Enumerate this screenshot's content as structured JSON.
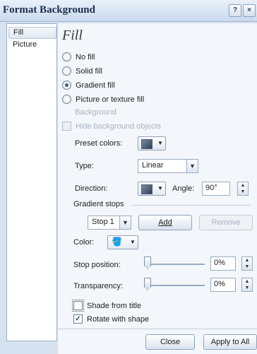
{
  "window": {
    "title": "Format Background",
    "help_glyph": "?",
    "close_glyph": "×"
  },
  "nav": {
    "items": [
      {
        "label": "Fill",
        "selected": true
      },
      {
        "label": "Picture",
        "selected": false
      }
    ]
  },
  "panel": {
    "heading": "Fill",
    "fill_options": [
      {
        "label": "No fill",
        "selected": false
      },
      {
        "label": "Solid fill",
        "selected": false
      },
      {
        "label": "Gradient fill",
        "selected": true
      },
      {
        "label": "Picture or texture fill",
        "selected": false
      }
    ],
    "background_label": "Background",
    "hide_background_label": "Hide background objects",
    "preset_colors_label": "Preset colors:",
    "type_label": "Type:",
    "type_value": "Linear",
    "direction_label": "Direction:",
    "angle_label": "Angle:",
    "angle_value": "90°",
    "gradient_stops_label": "Gradient stops",
    "stop_value": "Stop 1",
    "add_label": "Add",
    "remove_label": "Remove",
    "color_label": "Color:",
    "stop_position_label": "Stop position:",
    "stop_position_value": "0%",
    "transparency_label": "Transparency:",
    "transparency_value": "0%",
    "shade_from_title_label": "Shade from title",
    "shade_from_title_checked": false,
    "rotate_with_shape_label": "Rotate with shape",
    "rotate_with_shape_checked": true
  },
  "footer": {
    "close_label": "Close",
    "apply_all_label": "Apply to All"
  },
  "icons": {
    "dropdown": "chevron-down-icon",
    "spin": "spinner-icon",
    "paint_bucket": "paint-bucket-icon"
  }
}
